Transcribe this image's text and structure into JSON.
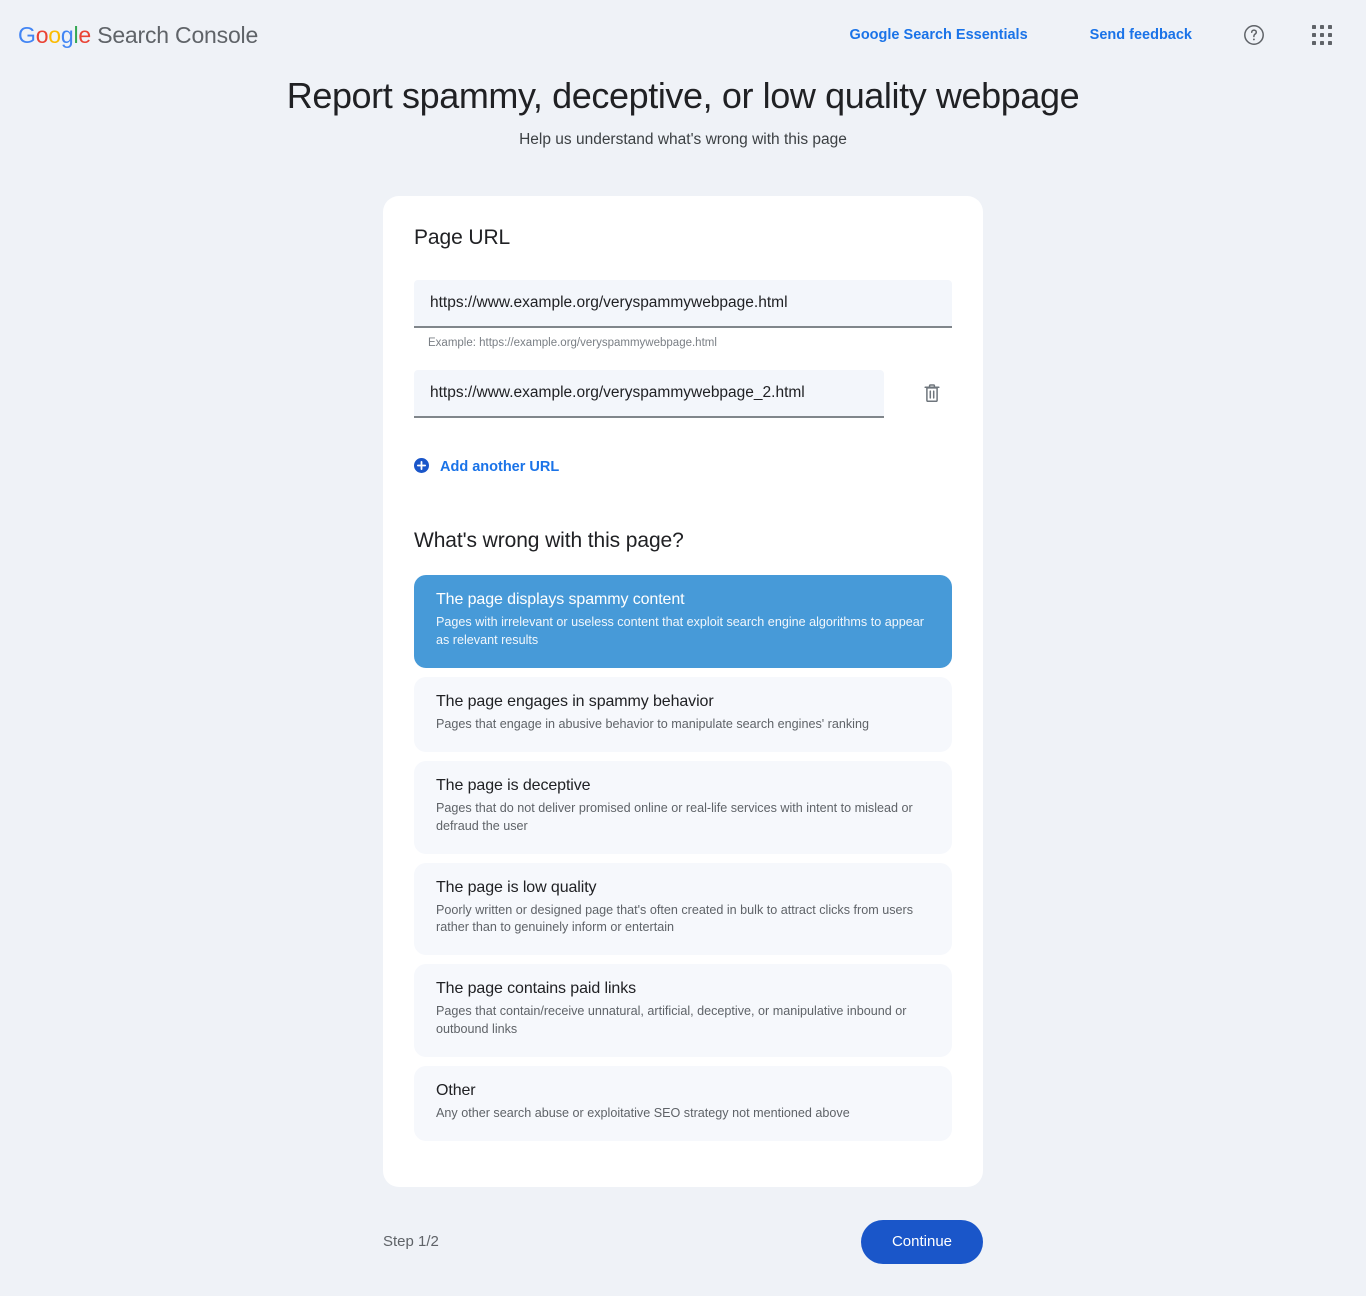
{
  "header": {
    "brand_google": "Google",
    "brand_product": " Search Console",
    "links": [
      {
        "label": "Google Search Essentials"
      },
      {
        "label": "Send feedback"
      }
    ],
    "help_icon": "help-circle-icon",
    "apps_icon": "apps-grid-icon"
  },
  "page": {
    "title": "Report spammy, deceptive, or low quality webpage",
    "subtitle": "Help us understand what's wrong with this page"
  },
  "url_section": {
    "title": "Page URL",
    "fields": [
      {
        "value": "https://www.example.org/veryspammywebpage.html",
        "placeholder": "https://example.org/veryspammywebpage.html",
        "hint": "Example: https://example.org/veryspammywebpage.html"
      },
      {
        "value": "https://www.example.org/veryspammywebpage_2.html",
        "placeholder": "https://example.org/veryspammywebpage.html",
        "delete_icon": "trash-icon"
      }
    ],
    "add_another_label": "Add another URL",
    "add_icon": "plus-circle-icon"
  },
  "question_section": {
    "title": "What's wrong with this page?",
    "options": [
      {
        "title": "The page displays spammy content",
        "desc": "Pages with irrelevant or useless content that exploit search engine algorithms to appear as relevant results",
        "selected": true
      },
      {
        "title": "The page engages in spammy behavior",
        "desc": "Pages that engage in abusive behavior to manipulate search engines' ranking",
        "selected": false
      },
      {
        "title": "The page is deceptive",
        "desc": "Pages that do not deliver promised online or real-life services with intent to mislead or defraud the user",
        "selected": false
      },
      {
        "title": "The page is low quality",
        "desc": "Poorly written or designed page that's often created in bulk to attract clicks from users rather than to genuinely inform or entertain",
        "selected": false
      },
      {
        "title": "The page contains paid links",
        "desc": "Pages that contain/receive unnatural, artificial, deceptive, or manipulative inbound or outbound links",
        "selected": false
      },
      {
        "title": "Other",
        "desc": "Any other search abuse or exploitative SEO strategy not mentioned above",
        "selected": false
      }
    ]
  },
  "footer": {
    "step": "Step 1/2",
    "continue_label": "Continue"
  },
  "colors": {
    "page_bg": "#eff2f7",
    "card_bg": "#ffffff",
    "link_blue": "#1a73e8",
    "selected_option": "#479ad8",
    "primary_button": "#1a56c9",
    "option_bg": "#f6f8fc",
    "input_bg": "#f3f6fb"
  }
}
